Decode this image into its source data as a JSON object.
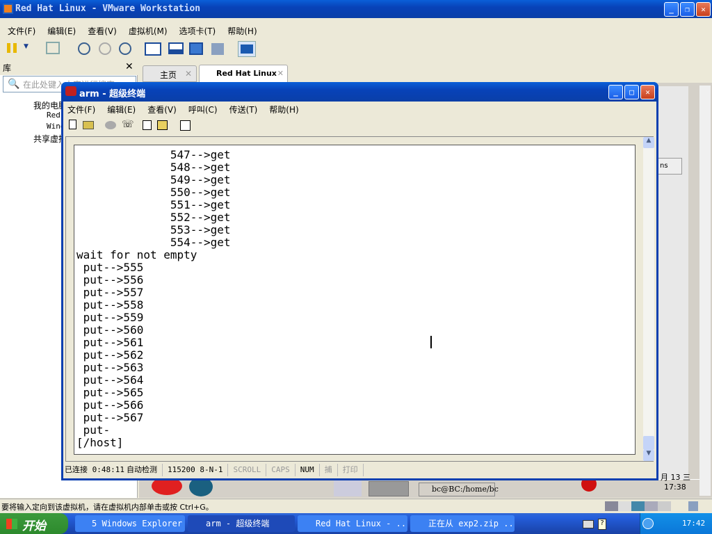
{
  "vmware": {
    "title": "Red Hat Linux - VMware Workstation",
    "menu": [
      "文件(F)",
      "编辑(E)",
      "查看(V)",
      "虚拟机(M)",
      "选项卡(T)",
      "帮助(H)"
    ],
    "library": {
      "title": "库",
      "search_placeholder": "在此处键入内容进行搜索",
      "tree": [
        "我的电脑",
        "Red Hat Linux",
        "Windows",
        "共享虚拟机"
      ]
    },
    "tabs": [
      {
        "label": "主页"
      },
      {
        "label": "Red Hat Linux"
      }
    ],
    "status_hint": "要将输入定向到该虚拟机，请在虚拟机内部单击或按 Ctrl+G。"
  },
  "guest": {
    "clock_date": "月 13 三",
    "clock_time": "17:38",
    "task": "bc@BC:/home/bc",
    "dropdown": "ns"
  },
  "terminal": {
    "title": "arm - 超级终端",
    "menu": [
      "文件(F)",
      "编辑(E)",
      "查看(V)",
      "呼叫(C)",
      "传送(T)",
      "帮助(H)"
    ],
    "lines": [
      "              547-->get",
      "              548-->get",
      "              549-->get",
      "              550-->get",
      "              551-->get",
      "              552-->get",
      "              553-->get",
      "              554-->get",
      "wait for not empty",
      " put-->555",
      " put-->556",
      " put-->557",
      " put-->558",
      " put-->559",
      " put-->560",
      " put-->561",
      " put-->562",
      " put-->563",
      " put-->564",
      " put-->565",
      " put-->566",
      " put-->567",
      " put-",
      "[/host]"
    ],
    "status": [
      "已连接 0:48:11",
      "自动检测",
      "115200 8-N-1",
      "SCROLL",
      "CAPS",
      "NUM",
      "捕",
      "打印"
    ]
  },
  "taskbar": {
    "start": "开始",
    "items": [
      "5 Windows Explorer",
      "arm - 超级终端",
      "Red Hat Linux - ...",
      "正在从 exp2.zip ..."
    ],
    "time": "17:42"
  }
}
